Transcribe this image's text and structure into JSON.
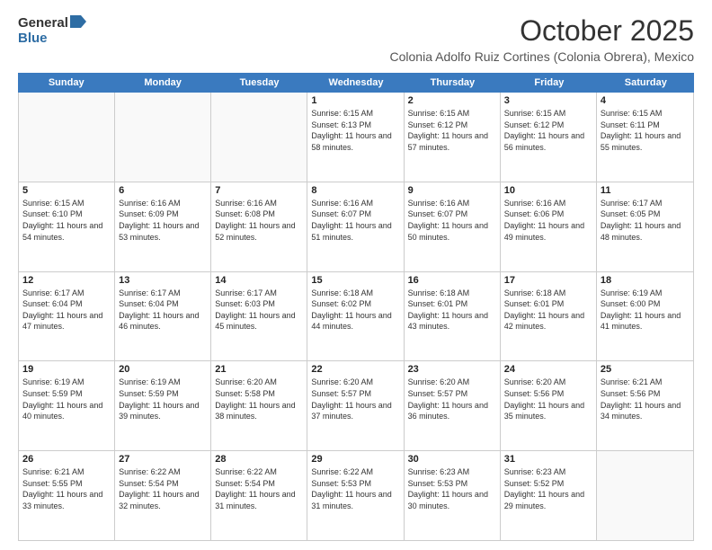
{
  "logo": {
    "general": "General",
    "blue": "Blue"
  },
  "title": "October 2025",
  "location": "Colonia Adolfo Ruiz Cortines (Colonia Obrera), Mexico",
  "header": {
    "days": [
      "Sunday",
      "Monday",
      "Tuesday",
      "Wednesday",
      "Thursday",
      "Friday",
      "Saturday"
    ]
  },
  "weeks": [
    [
      {
        "day": "",
        "empty": true
      },
      {
        "day": "",
        "empty": true
      },
      {
        "day": "",
        "empty": true
      },
      {
        "day": "1",
        "sunrise": "Sunrise: 6:15 AM",
        "sunset": "Sunset: 6:13 PM",
        "daylight": "Daylight: 11 hours and 58 minutes."
      },
      {
        "day": "2",
        "sunrise": "Sunrise: 6:15 AM",
        "sunset": "Sunset: 6:12 PM",
        "daylight": "Daylight: 11 hours and 57 minutes."
      },
      {
        "day": "3",
        "sunrise": "Sunrise: 6:15 AM",
        "sunset": "Sunset: 6:12 PM",
        "daylight": "Daylight: 11 hours and 56 minutes."
      },
      {
        "day": "4",
        "sunrise": "Sunrise: 6:15 AM",
        "sunset": "Sunset: 6:11 PM",
        "daylight": "Daylight: 11 hours and 55 minutes."
      }
    ],
    [
      {
        "day": "5",
        "sunrise": "Sunrise: 6:15 AM",
        "sunset": "Sunset: 6:10 PM",
        "daylight": "Daylight: 11 hours and 54 minutes."
      },
      {
        "day": "6",
        "sunrise": "Sunrise: 6:16 AM",
        "sunset": "Sunset: 6:09 PM",
        "daylight": "Daylight: 11 hours and 53 minutes."
      },
      {
        "day": "7",
        "sunrise": "Sunrise: 6:16 AM",
        "sunset": "Sunset: 6:08 PM",
        "daylight": "Daylight: 11 hours and 52 minutes."
      },
      {
        "day": "8",
        "sunrise": "Sunrise: 6:16 AM",
        "sunset": "Sunset: 6:07 PM",
        "daylight": "Daylight: 11 hours and 51 minutes."
      },
      {
        "day": "9",
        "sunrise": "Sunrise: 6:16 AM",
        "sunset": "Sunset: 6:07 PM",
        "daylight": "Daylight: 11 hours and 50 minutes."
      },
      {
        "day": "10",
        "sunrise": "Sunrise: 6:16 AM",
        "sunset": "Sunset: 6:06 PM",
        "daylight": "Daylight: 11 hours and 49 minutes."
      },
      {
        "day": "11",
        "sunrise": "Sunrise: 6:17 AM",
        "sunset": "Sunset: 6:05 PM",
        "daylight": "Daylight: 11 hours and 48 minutes."
      }
    ],
    [
      {
        "day": "12",
        "sunrise": "Sunrise: 6:17 AM",
        "sunset": "Sunset: 6:04 PM",
        "daylight": "Daylight: 11 hours and 47 minutes."
      },
      {
        "day": "13",
        "sunrise": "Sunrise: 6:17 AM",
        "sunset": "Sunset: 6:04 PM",
        "daylight": "Daylight: 11 hours and 46 minutes."
      },
      {
        "day": "14",
        "sunrise": "Sunrise: 6:17 AM",
        "sunset": "Sunset: 6:03 PM",
        "daylight": "Daylight: 11 hours and 45 minutes."
      },
      {
        "day": "15",
        "sunrise": "Sunrise: 6:18 AM",
        "sunset": "Sunset: 6:02 PM",
        "daylight": "Daylight: 11 hours and 44 minutes."
      },
      {
        "day": "16",
        "sunrise": "Sunrise: 6:18 AM",
        "sunset": "Sunset: 6:01 PM",
        "daylight": "Daylight: 11 hours and 43 minutes."
      },
      {
        "day": "17",
        "sunrise": "Sunrise: 6:18 AM",
        "sunset": "Sunset: 6:01 PM",
        "daylight": "Daylight: 11 hours and 42 minutes."
      },
      {
        "day": "18",
        "sunrise": "Sunrise: 6:19 AM",
        "sunset": "Sunset: 6:00 PM",
        "daylight": "Daylight: 11 hours and 41 minutes."
      }
    ],
    [
      {
        "day": "19",
        "sunrise": "Sunrise: 6:19 AM",
        "sunset": "Sunset: 5:59 PM",
        "daylight": "Daylight: 11 hours and 40 minutes."
      },
      {
        "day": "20",
        "sunrise": "Sunrise: 6:19 AM",
        "sunset": "Sunset: 5:59 PM",
        "daylight": "Daylight: 11 hours and 39 minutes."
      },
      {
        "day": "21",
        "sunrise": "Sunrise: 6:20 AM",
        "sunset": "Sunset: 5:58 PM",
        "daylight": "Daylight: 11 hours and 38 minutes."
      },
      {
        "day": "22",
        "sunrise": "Sunrise: 6:20 AM",
        "sunset": "Sunset: 5:57 PM",
        "daylight": "Daylight: 11 hours and 37 minutes."
      },
      {
        "day": "23",
        "sunrise": "Sunrise: 6:20 AM",
        "sunset": "Sunset: 5:57 PM",
        "daylight": "Daylight: 11 hours and 36 minutes."
      },
      {
        "day": "24",
        "sunrise": "Sunrise: 6:20 AM",
        "sunset": "Sunset: 5:56 PM",
        "daylight": "Daylight: 11 hours and 35 minutes."
      },
      {
        "day": "25",
        "sunrise": "Sunrise: 6:21 AM",
        "sunset": "Sunset: 5:56 PM",
        "daylight": "Daylight: 11 hours and 34 minutes."
      }
    ],
    [
      {
        "day": "26",
        "sunrise": "Sunrise: 6:21 AM",
        "sunset": "Sunset: 5:55 PM",
        "daylight": "Daylight: 11 hours and 33 minutes."
      },
      {
        "day": "27",
        "sunrise": "Sunrise: 6:22 AM",
        "sunset": "Sunset: 5:54 PM",
        "daylight": "Daylight: 11 hours and 32 minutes."
      },
      {
        "day": "28",
        "sunrise": "Sunrise: 6:22 AM",
        "sunset": "Sunset: 5:54 PM",
        "daylight": "Daylight: 11 hours and 31 minutes."
      },
      {
        "day": "29",
        "sunrise": "Sunrise: 6:22 AM",
        "sunset": "Sunset: 5:53 PM",
        "daylight": "Daylight: 11 hours and 31 minutes."
      },
      {
        "day": "30",
        "sunrise": "Sunrise: 6:23 AM",
        "sunset": "Sunset: 5:53 PM",
        "daylight": "Daylight: 11 hours and 30 minutes."
      },
      {
        "day": "31",
        "sunrise": "Sunrise: 6:23 AM",
        "sunset": "Sunset: 5:52 PM",
        "daylight": "Daylight: 11 hours and 29 minutes."
      },
      {
        "day": "",
        "empty": true
      }
    ]
  ]
}
